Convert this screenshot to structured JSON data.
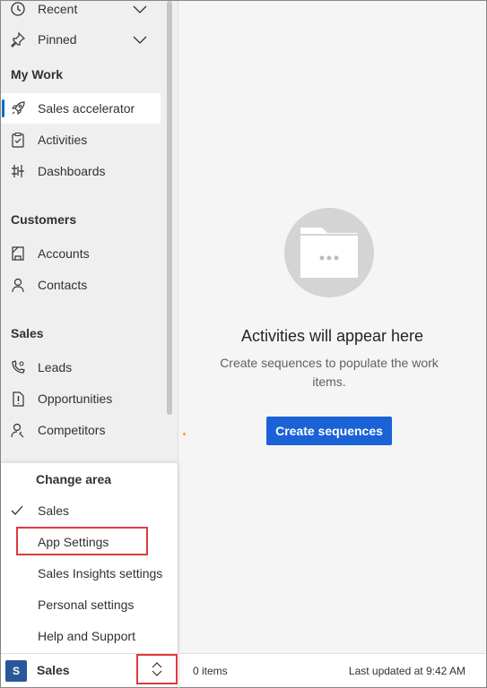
{
  "sidebar": {
    "items_top": [
      {
        "label": "Recent",
        "icon": "clock-icon"
      },
      {
        "label": "Pinned",
        "icon": "pin-icon"
      }
    ],
    "sections": [
      {
        "title": "My Work",
        "items": [
          {
            "label": "Sales accelerator",
            "icon": "rocket-icon",
            "selected": true
          },
          {
            "label": "Activities",
            "icon": "clipboard-icon"
          },
          {
            "label": "Dashboards",
            "icon": "dashboard-icon"
          }
        ]
      },
      {
        "title": "Customers",
        "items": [
          {
            "label": "Accounts",
            "icon": "building-icon"
          },
          {
            "label": "Contacts",
            "icon": "person-icon"
          }
        ]
      },
      {
        "title": "Sales",
        "items": [
          {
            "label": "Leads",
            "icon": "phone-person-icon"
          },
          {
            "label": "Opportunities",
            "icon": "document-exclaim-icon"
          },
          {
            "label": "Competitors",
            "icon": "person-search-icon"
          }
        ]
      }
    ]
  },
  "main": {
    "empty_title": "Activities will appear here",
    "empty_desc": "Create sequences to populate the work items.",
    "create_button": "Create sequences"
  },
  "flyout": {
    "title": "Change area",
    "items": [
      {
        "label": "Sales",
        "checked": true
      },
      {
        "label": "App Settings",
        "highlighted": true
      },
      {
        "label": "Sales Insights settings"
      },
      {
        "label": "Personal settings"
      },
      {
        "label": "Help and Support"
      }
    ]
  },
  "bottombar": {
    "area_initial": "S",
    "area_name": "Sales",
    "items_count": "0 items",
    "last_updated": "Last updated at 9:42 AM"
  },
  "colors": {
    "accent": "#1a62d6",
    "highlight": "#e0393e",
    "selection_bar": "#0f6cbd"
  }
}
